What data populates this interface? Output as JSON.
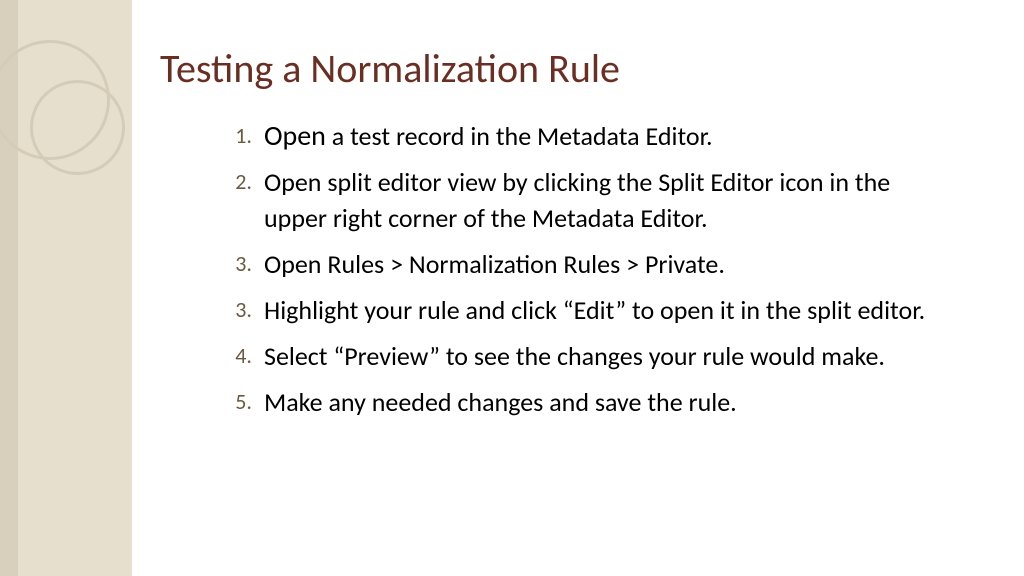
{
  "title": "Testing a Normalization Rule",
  "items": [
    {
      "num": "1.",
      "lead": "Open",
      "rest": " a test record in the Metadata Editor."
    },
    {
      "num": "2.",
      "lead": "",
      "rest": "Open split editor view by clicking the Split Editor icon in the upper right corner of the Metadata Editor."
    },
    {
      "num": "3.",
      "lead": "",
      "rest": "Open Rules  > Normalization Rules > Private."
    },
    {
      "num": "3.",
      "lead": "",
      "rest": "Highlight your rule and click “Edit” to open it in the split editor."
    },
    {
      "num": "4.",
      "lead": "",
      "rest": "Select “Preview” to see the changes your rule would make."
    },
    {
      "num": "5.",
      "lead": "",
      "rest": "Make any needed changes and save the rule."
    }
  ]
}
